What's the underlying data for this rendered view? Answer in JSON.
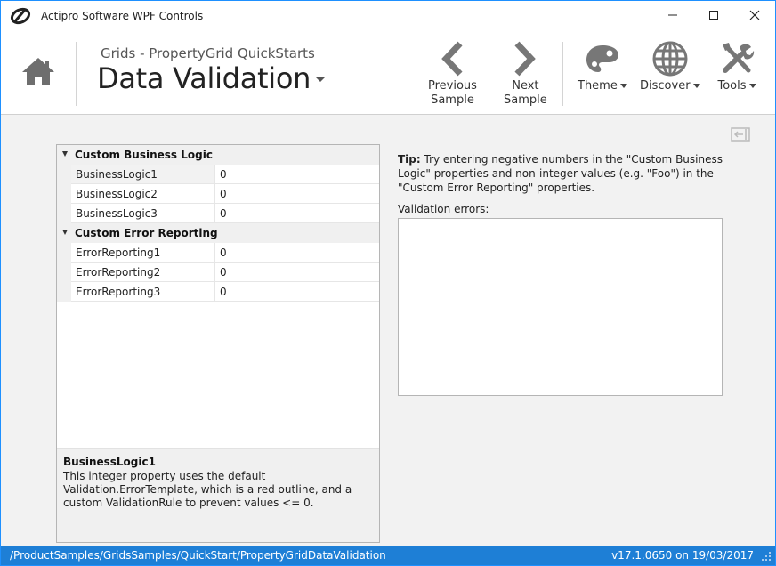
{
  "window": {
    "title": "Actipro Software WPF Controls"
  },
  "header": {
    "breadcrumb": "Grids - PropertyGrid QuickStarts",
    "title": "Data Validation",
    "buttons": {
      "previous_line1": "Previous",
      "previous_line2": "Sample",
      "next_line1": "Next",
      "next_line2": "Sample",
      "theme": "Theme",
      "discover": "Discover",
      "tools": "Tools"
    }
  },
  "property_grid": {
    "categories": [
      {
        "name": "Custom Business Logic",
        "properties": [
          {
            "name": "BusinessLogic1",
            "value": "0"
          },
          {
            "name": "BusinessLogic2",
            "value": "0"
          },
          {
            "name": "BusinessLogic3",
            "value": "0"
          }
        ]
      },
      {
        "name": "Custom Error Reporting",
        "properties": [
          {
            "name": "ErrorReporting1",
            "value": "0"
          },
          {
            "name": "ErrorReporting2",
            "value": "0"
          },
          {
            "name": "ErrorReporting3",
            "value": "0"
          }
        ]
      }
    ],
    "description": {
      "title": "BusinessLogic1",
      "text": "This integer property uses the default Validation.ErrorTemplate, which is a red outline, and a custom ValidationRule to prevent values <= 0."
    }
  },
  "tip": {
    "label": "Tip:",
    "text": " Try entering negative numbers in the \"Custom Business Logic\" properties and non-integer values (e.g. \"Foo\") in the \"Custom Error Reporting\" properties."
  },
  "validation": {
    "label": "Validation errors:"
  },
  "status": {
    "path": "/ProductSamples/GridsSamples/QuickStart/PropertyGridDataValidation",
    "version": "v17.1.0650 on 19/03/2017"
  },
  "colors": {
    "accent": "#1e7fd6",
    "window_border": "#1e90ff",
    "icon_gray": "#777777"
  }
}
